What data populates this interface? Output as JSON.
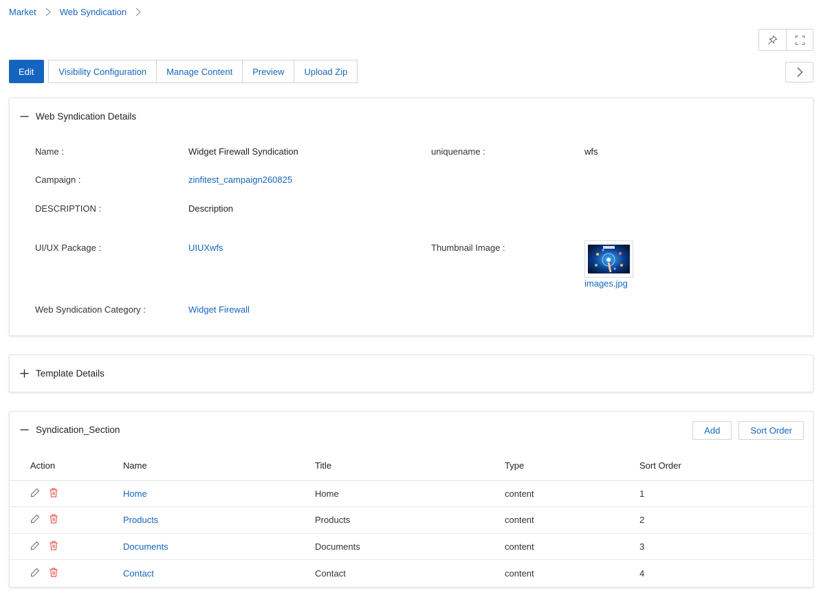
{
  "breadcrumb": {
    "items": [
      "Market",
      "Web Syndication"
    ]
  },
  "tabs": [
    "Edit",
    "Visibility Configuration",
    "Manage Content",
    "Preview",
    "Upload Zip"
  ],
  "details": {
    "title": "Web Syndication Details",
    "name_label": "Name :",
    "name_value": "Widget Firewall Syndication",
    "uniquename_label": "uniquename :",
    "uniquename_value": "wfs",
    "campaign_label": "Campaign :",
    "campaign_value": "zinfitest_campaign260825",
    "description_label": "DESCRIPTION :",
    "description_value": "Description",
    "uiux_label": "UI/UX Package :",
    "uiux_value": "UIUXwfs",
    "thumbnail_label": "Thumbnail Image :",
    "thumbnail_file": "images.jpg",
    "category_label": "Web Syndication Category :",
    "category_value": "Widget Firewall"
  },
  "template": {
    "title": "Template Details"
  },
  "section": {
    "title": "Syndication_Section",
    "add_label": "Add",
    "sort_label": "Sort Order",
    "columns": [
      "Action",
      "Name",
      "Title",
      "Type",
      "Sort Order"
    ],
    "rows": [
      {
        "name": "Home",
        "title": "Home",
        "type": "content",
        "sort": "1"
      },
      {
        "name": "Products",
        "title": "Products",
        "type": "content",
        "sort": "2"
      },
      {
        "name": "Documents",
        "title": "Documents",
        "type": "content",
        "sort": "3"
      },
      {
        "name": "Contact",
        "title": "Contact",
        "type": "content",
        "sort": "4"
      }
    ]
  },
  "colors": {
    "accent": "#1565c0",
    "delete": "#e53935",
    "border": "#cfd4d9"
  },
  "icons": [
    "chevron-right-icon",
    "pin-icon",
    "fullscreen-icon",
    "minus-icon",
    "plus-icon",
    "edit-icon",
    "trash-icon"
  ]
}
